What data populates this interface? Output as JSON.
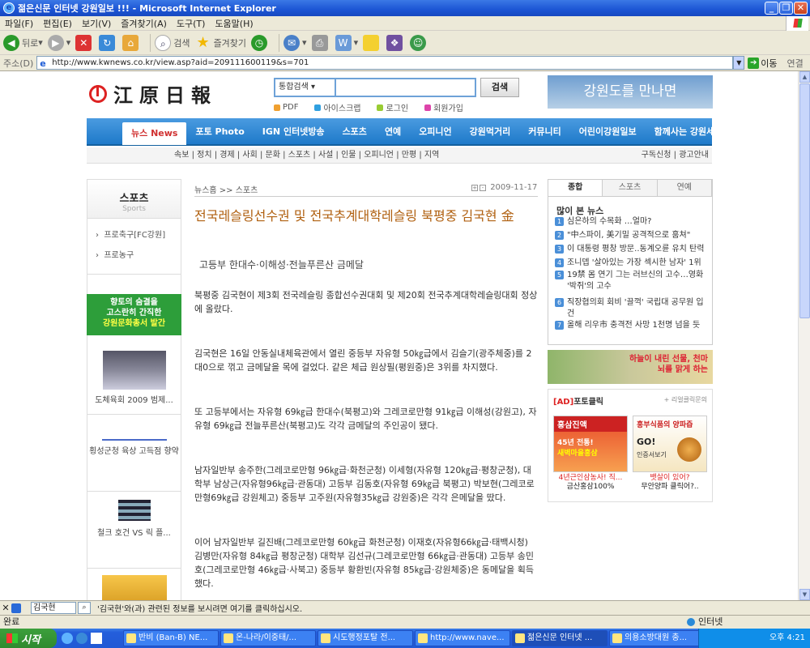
{
  "window": {
    "title": "젊은신문 인터넷 강원일보 !!! - Microsoft Internet Explorer"
  },
  "menu": [
    "파일(F)",
    "편집(E)",
    "보기(V)",
    "즐겨찾기(A)",
    "도구(T)",
    "도움말(H)"
  ],
  "toolbar": {
    "back": "뒤로",
    "search": "검색",
    "favorites": "즐겨찾기"
  },
  "address": {
    "label": "주소(D)",
    "url": "http://www.kwnews.co.kr/view.asp?aid=209111600119&s=701",
    "go": "이동",
    "links": "연결"
  },
  "site": {
    "logo": "江原日報",
    "search": {
      "scope": "통합검색",
      "button": "검색"
    },
    "quicklinks": [
      {
        "label": "PDF",
        "color": "#f0a030"
      },
      {
        "label": "아이스크랩",
        "color": "#30a0e0"
      },
      {
        "label": "로그인",
        "color": "#9c3"
      },
      {
        "label": "회원가입",
        "color": "#d4a"
      }
    ],
    "banner": "강원도를 만나면",
    "nav": [
      "뉴스 News",
      "포토 Photo",
      "IGN 인터넷방송",
      "스포츠",
      "연예",
      "오피니언",
      "강원먹거리",
      "커뮤니티",
      "어린이강원일보",
      "함께사는 강원세상"
    ],
    "subnav": "속보 | 정치 | 경제 | 사회 | 문화 | 스포츠 | 사설 | 인물 | 오피니언 | 만평 | 지역",
    "subnav_right": "구독신청 | 광고안내"
  },
  "left": {
    "title": "스포츠",
    "subtitle": "Sports",
    "links": [
      "프로축구[FC강원]",
      "프로농구"
    ],
    "banner": {
      "line1": "향토의 숨결을",
      "line2": "고스란히 간직한",
      "line3": "강원문화총서 발간"
    },
    "thumbs": [
      "도체육회 2009 범제...",
      "횡성군청 육상 고득점 향약",
      "철크 호건 VS 릭 플..."
    ]
  },
  "article": {
    "breadcrumb": "뉴스홈 >> 스포츠",
    "date": "2009-11-17",
    "headline": "전국레슬링선수권 및 전국추계대학레슬링 북평중 김국현 金",
    "subhead": "고등부 한대수·이해성·전늘푸른산 금메달",
    "paragraphs": [
      "북평중 김국현이 제3회 전국레슬링 종합선수권대회 및 제20회 전국추계대학레슬링대회 정상에 올랐다.",
      "김국현은 16일 안동실내체육관에서 열린 중등부 자유형 50㎏급에서 김슬기(광주체중)를 2대0으로 꺾고 금메달을 목에 걸었다. 같은 체급 원상필(평원중)은 3위를 차지했다.",
      "또 고등부에서는 자유형 69㎏급 한대수(북평고)와 그레코로만형 91㎏급 이해성(강원고), 자유형 69㎏급 전늘푸른산(북평고)도 각각 금메달의 주인공이 됐다.",
      "남자일반부 송주한(그레코로만형 96㎏급·화천군청) 이세형(자유형 120㎏급·평창군청), 대학부 남상근(자유형96㎏급·관동대) 고등부 김동호(자유형 69㎏급 북평고) 박보현(그레코로만형69㎏급 강원체고) 중등부 고주원(자유형35㎏급 강원중)은 각각 은메달을 땄다.",
      "이어 남자일반부 길진배(그레코로만형 60㎏급 화천군청) 이재호(자유형66㎏급·태백시청) 김병만(자유형 84㎏급 평창군청) 대학부 김선규(그레코로만형 66㎏급·관동대) 고등부 송민호(그레코로만형 46㎏급·사북고) 중등부 황환빈(자유형 85㎏급·강원체중)은 동메달을 획득했다."
    ]
  },
  "right": {
    "tabs": [
      "종합",
      "스포츠",
      "연예"
    ],
    "popular_title": "많이 본 뉴스",
    "popular": [
      "심은하의 수목화 …얼마?",
      "\"中스파이, 美기밀 공격적으로 훔쳐\"",
      "이 대통령 평창 방문..동계오륜 유치 탄력",
      "조니뎁 '살아있는 가장 섹시한 남자' 1위",
      "19禁 몸 연기 그는 러브신의 고수…영화 '박쥐'의 고수",
      "직장협의회 회비 '끌꺽' 국립대 공무원 입건",
      "올해 리우市 충격전 사망 1천명 넘을 듯"
    ],
    "banner": "하늘이 내린 선물, 천마\n뇌를 맑게 하는",
    "photoclick": {
      "label": "포토클릭",
      "ad_tag": "[AD]",
      "more": "+ 리얼클릭문의"
    },
    "ads": [
      {
        "title": "홍삼진액",
        "caption1": "45년 전통!",
        "caption2": "새벽마을홍삼",
        "link": "4년근인삼농사! 직...",
        "sub": "금산홍삼100%"
      },
      {
        "title": "홍부식품의 양파즙",
        "caption1": "GO!",
        "caption2": "인증서보기",
        "link": "뱃살이 있어?",
        "sub": "무안양파 클릭어?.."
      }
    ]
  },
  "findbar": {
    "query": "김국현",
    "message": "'김국현'와(과) 관련된 정보를 보시려면 여기를 클릭하십시오."
  },
  "status": {
    "left": "완료",
    "zone": "인터넷"
  },
  "taskbar": {
    "start": "시작",
    "tasks": [
      "반비 (Ban-B) NE...",
      "온-나라/이중태/...",
      "시도행정포탈 전...",
      "http://www.nave...",
      "젊은신문 인터넷 ...",
      "의용소방대원 충..."
    ],
    "active": 4,
    "clock": "오후 4:21"
  }
}
